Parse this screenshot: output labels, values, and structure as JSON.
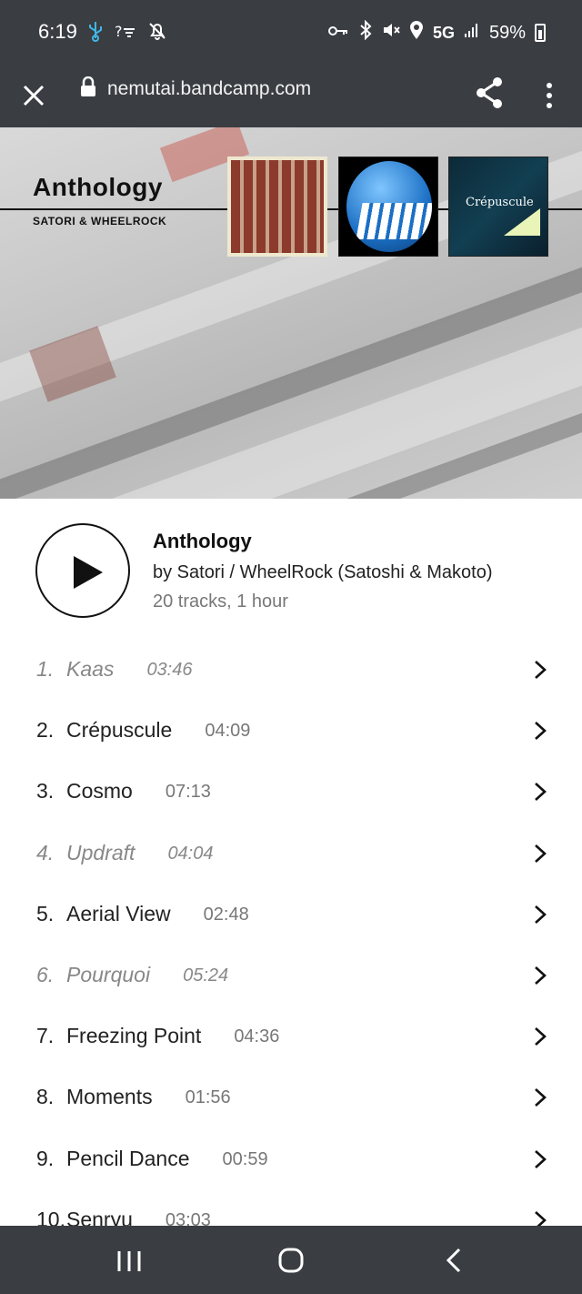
{
  "status_bar": {
    "time": "6:19",
    "network": "5G",
    "battery": "59%"
  },
  "browser": {
    "url": "nemutai.bandcamp.com"
  },
  "banner": {
    "title": "Anthology",
    "artist": "SATORI & WHEELROCK",
    "thumb_label": "Crépuscule"
  },
  "album": {
    "title": "Anthology",
    "by": "by Satori / WheelRock (Satoshi & Makoto)",
    "meta": "20 tracks, 1 hour"
  },
  "tracks": [
    {
      "num": "1.",
      "title": "Kaas",
      "duration": "03:46",
      "unavailable": true
    },
    {
      "num": "2.",
      "title": "Crépuscule",
      "duration": "04:09",
      "unavailable": false
    },
    {
      "num": "3.",
      "title": "Cosmo",
      "duration": "07:13",
      "unavailable": false
    },
    {
      "num": "4.",
      "title": "Updraft",
      "duration": "04:04",
      "unavailable": true
    },
    {
      "num": "5.",
      "title": "Aerial View",
      "duration": "02:48",
      "unavailable": false
    },
    {
      "num": "6.",
      "title": "Pourquoi",
      "duration": "05:24",
      "unavailable": true
    },
    {
      "num": "7.",
      "title": "Freezing Point",
      "duration": "04:36",
      "unavailable": false
    },
    {
      "num": "8.",
      "title": "Moments",
      "duration": "01:56",
      "unavailable": false
    },
    {
      "num": "9.",
      "title": "Pencil Dance",
      "duration": "00:59",
      "unavailable": false
    },
    {
      "num": "10.",
      "title": "Senryu",
      "duration": "03:03",
      "unavailable": false
    }
  ],
  "colors": {
    "chrome": "#3a3d42",
    "text": "#222222",
    "muted": "#777777"
  }
}
